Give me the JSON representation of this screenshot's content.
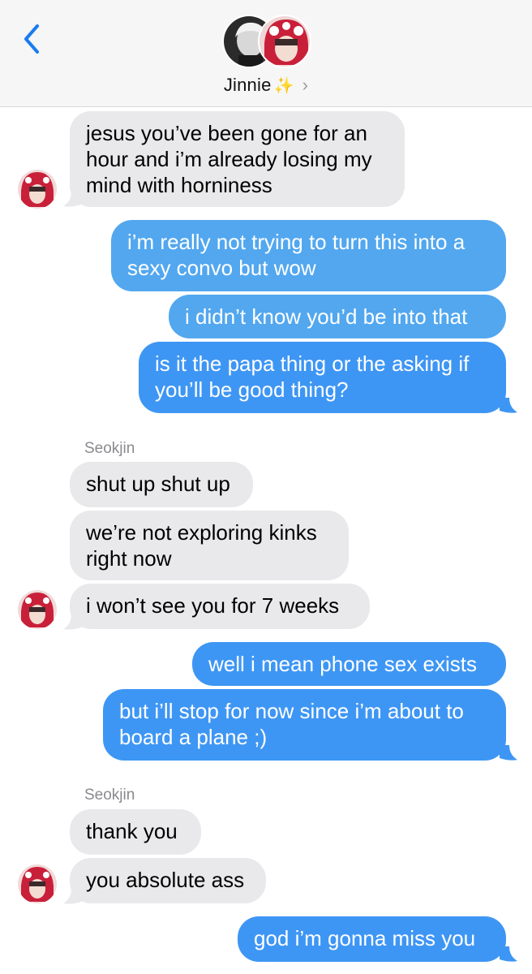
{
  "header": {
    "contact_name": "Jinnie",
    "sparkle_icon": "sparkles-icon",
    "chevron": "›",
    "back_icon": "chevron-left-icon"
  },
  "messages": [
    {
      "side": "in",
      "lines": [
        "jesus you’ve been gone for an",
        "hour and i’m already losing my",
        "mind with horniness"
      ]
    },
    {
      "side": "out",
      "lines": [
        "i’m really not trying to turn this into a",
        "sexy convo but wow"
      ]
    },
    {
      "side": "out",
      "lines": [
        "i didn’t know you’d be into that"
      ]
    },
    {
      "side": "out",
      "lines": [
        "is it the papa thing or the asking if",
        "you’ll be good thing?"
      ]
    },
    {
      "sender": "Seokjin"
    },
    {
      "side": "in",
      "lines": [
        "shut up shut up"
      ]
    },
    {
      "side": "in",
      "lines": [
        "we’re not exploring kinks",
        "right now"
      ]
    },
    {
      "side": "in",
      "lines": [
        "i won’t see you for 7 weeks"
      ]
    },
    {
      "side": "out",
      "lines": [
        "well i mean phone sex exists"
      ]
    },
    {
      "side": "out",
      "lines": [
        "but i’ll stop for now since i’m about to",
        "board a plane ;)"
      ]
    },
    {
      "sender": "Seokjin"
    },
    {
      "side": "in",
      "lines": [
        "thank you"
      ]
    },
    {
      "side": "in",
      "lines": [
        "you absolute ass"
      ]
    },
    {
      "side": "out",
      "lines": [
        "god i’m gonna miss you"
      ]
    }
  ],
  "colors": {
    "incoming_bubble": "#e9e9eb",
    "outgoing_bubble": "#3e96f4",
    "accent": "#007aff"
  }
}
